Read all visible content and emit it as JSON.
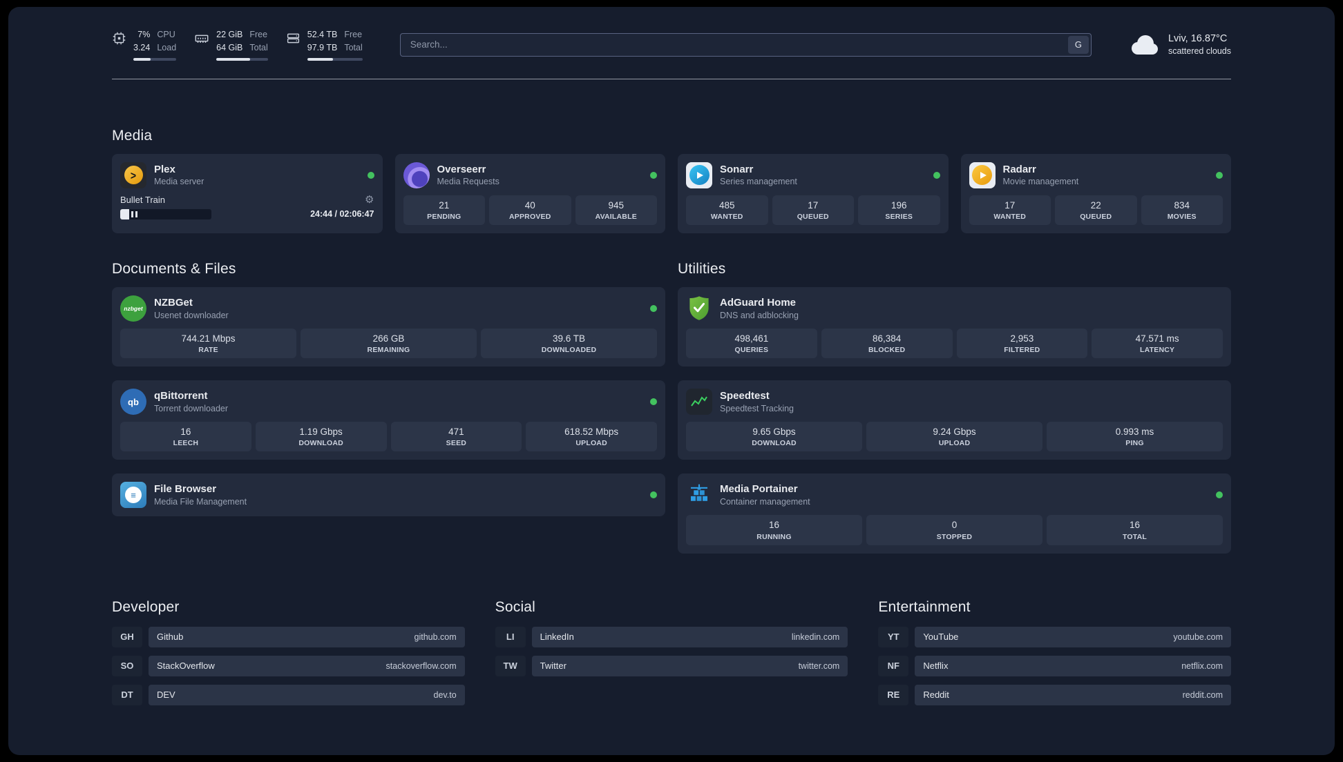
{
  "colors": {
    "status_online": "#43c25f",
    "panel_bg": "#161d2d",
    "card_bg": "#232b3d",
    "tile_bg": "#2c3548"
  },
  "header": {
    "cpu": {
      "value_top": "7%",
      "value_bottom": "3.24",
      "label_top": "CPU",
      "label_bottom": "Load",
      "bar_percent": 40
    },
    "memory": {
      "value_top": "22 GiB",
      "value_bottom": "64 GiB",
      "label_top": "Free",
      "label_bottom": "Total",
      "bar_percent": 66
    },
    "storage": {
      "value_top": "52.4 TB",
      "value_bottom": "97.9 TB",
      "label_top": "Free",
      "label_bottom": "Total",
      "bar_percent": 47
    },
    "search": {
      "placeholder": "Search...",
      "engine_label": "G"
    },
    "weather": {
      "location": "Lviv, 16.87°C",
      "condition": "scattered clouds"
    }
  },
  "sections": {
    "media": {
      "title": "Media",
      "apps": [
        {
          "id": "plex",
          "icon": "plex-icon",
          "name": "Plex",
          "desc": "Media server",
          "online": true,
          "player": {
            "title": "Bullet Train",
            "state": "paused",
            "progress_percent": 10,
            "time": "24:44 / 02:06:47"
          }
        },
        {
          "id": "overseerr",
          "icon": "overseerr-icon",
          "name": "Overseerr",
          "desc": "Media Requests",
          "online": true,
          "stats": [
            {
              "value": "21",
              "label": "PENDING"
            },
            {
              "value": "40",
              "label": "APPROVED"
            },
            {
              "value": "945",
              "label": "AVAILABLE"
            }
          ]
        },
        {
          "id": "sonarr",
          "icon": "sonarr-icon",
          "name": "Sonarr",
          "desc": "Series management",
          "online": true,
          "stats": [
            {
              "value": "485",
              "label": "WANTED"
            },
            {
              "value": "17",
              "label": "QUEUED"
            },
            {
              "value": "196",
              "label": "SERIES"
            }
          ]
        },
        {
          "id": "radarr",
          "icon": "radarr-icon",
          "name": "Radarr",
          "desc": "Movie management",
          "online": true,
          "stats": [
            {
              "value": "17",
              "label": "WANTED"
            },
            {
              "value": "22",
              "label": "QUEUED"
            },
            {
              "value": "834",
              "label": "MOVIES"
            }
          ]
        }
      ]
    },
    "documents": {
      "title": "Documents & Files",
      "apps": [
        {
          "id": "nzbget",
          "icon": "nzbget-icon",
          "name": "NZBGet",
          "desc": "Usenet downloader",
          "online": true,
          "stats": [
            {
              "value": "744.21 Mbps",
              "label": "RATE"
            },
            {
              "value": "266 GB",
              "label": "REMAINING"
            },
            {
              "value": "39.6 TB",
              "label": "DOWNLOADED"
            }
          ]
        },
        {
          "id": "qbittorrent",
          "icon": "qbittorrent-icon",
          "name": "qBittorrent",
          "desc": "Torrent downloader",
          "online": true,
          "stats": [
            {
              "value": "16",
              "label": "LEECH"
            },
            {
              "value": "1.19 Gbps",
              "label": "DOWNLOAD"
            },
            {
              "value": "471",
              "label": "SEED"
            },
            {
              "value": "618.52 Mbps",
              "label": "UPLOAD"
            }
          ]
        },
        {
          "id": "filebrowser",
          "icon": "filebrowser-icon",
          "name": "File Browser",
          "desc": "Media File Management",
          "online": true
        }
      ]
    },
    "utilities": {
      "title": "Utilities",
      "apps": [
        {
          "id": "adguard",
          "icon": "adguard-icon",
          "name": "AdGuard Home",
          "desc": "DNS and adblocking",
          "online": false,
          "stats": [
            {
              "value": "498,461",
              "label": "QUERIES"
            },
            {
              "value": "86,384",
              "label": "BLOCKED"
            },
            {
              "value": "2,953",
              "label": "FILTERED"
            },
            {
              "value": "47.571 ms",
              "label": "LATENCY"
            }
          ]
        },
        {
          "id": "speedtest",
          "icon": "speedtest-icon",
          "name": "Speedtest",
          "desc": "Speedtest Tracking",
          "online": false,
          "stats": [
            {
              "value": "9.65 Gbps",
              "label": "DOWNLOAD"
            },
            {
              "value": "9.24 Gbps",
              "label": "UPLOAD"
            },
            {
              "value": "0.993 ms",
              "label": "PING"
            }
          ]
        },
        {
          "id": "portainer",
          "icon": "portainer-icon",
          "name": "Media Portainer",
          "desc": "Container management",
          "online": true,
          "stats": [
            {
              "value": "16",
              "label": "RUNNING"
            },
            {
              "value": "0",
              "label": "STOPPED"
            },
            {
              "value": "16",
              "label": "TOTAL"
            }
          ]
        }
      ]
    }
  },
  "bookmarks": [
    {
      "title": "Developer",
      "items": [
        {
          "abbr": "GH",
          "name": "Github",
          "url": "github.com"
        },
        {
          "abbr": "SO",
          "name": "StackOverflow",
          "url": "stackoverflow.com"
        },
        {
          "abbr": "DT",
          "name": "DEV",
          "url": "dev.to"
        }
      ]
    },
    {
      "title": "Social",
      "items": [
        {
          "abbr": "LI",
          "name": "LinkedIn",
          "url": "linkedin.com"
        },
        {
          "abbr": "TW",
          "name": "Twitter",
          "url": "twitter.com"
        }
      ]
    },
    {
      "title": "Entertainment",
      "items": [
        {
          "abbr": "YT",
          "name": "YouTube",
          "url": "youtube.com"
        },
        {
          "abbr": "NF",
          "name": "Netflix",
          "url": "netflix.com"
        },
        {
          "abbr": "RE",
          "name": "Reddit",
          "url": "reddit.com"
        }
      ]
    }
  ]
}
